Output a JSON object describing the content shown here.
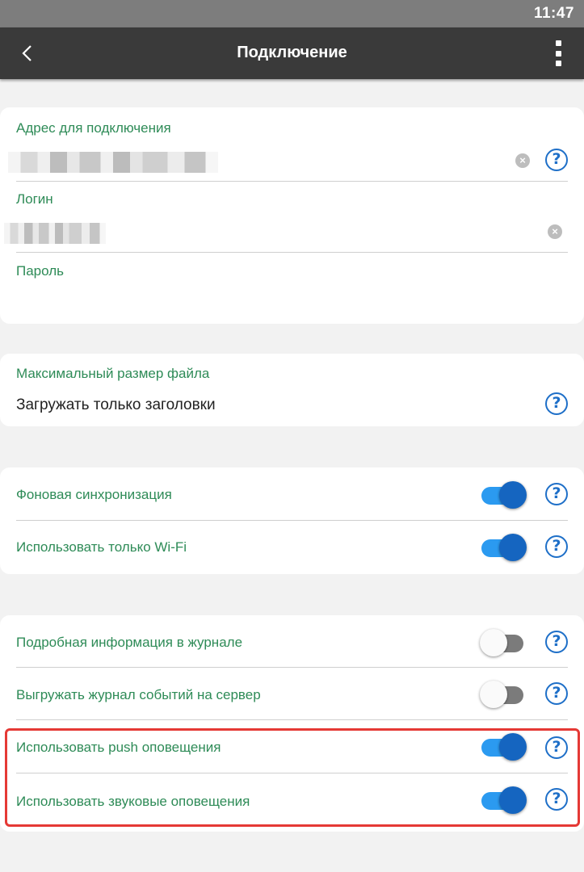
{
  "status_bar": {
    "time": "11:47"
  },
  "app_bar": {
    "title": "Подключение",
    "back_icon": "chevron-left-icon",
    "menu_icon": "more-vertical-icon"
  },
  "connection": {
    "address_label": "Адрес для подключения",
    "login_label": "Логин",
    "password_label": "Пароль"
  },
  "file_size": {
    "label": "Максимальный размер файла",
    "value": "Загружать только заголовки"
  },
  "sync": {
    "items": [
      {
        "label": "Фоновая синхронизация",
        "on": true
      },
      {
        "label": "Использовать только Wi-Fi",
        "on": true
      }
    ]
  },
  "logging": {
    "items": [
      {
        "label": "Подробная информация в журнале",
        "on": false
      },
      {
        "label": "Выгружать журнал событий на сервер",
        "on": false
      },
      {
        "label": "Использовать push оповещения",
        "on": true
      },
      {
        "label": "Использовать звуковые оповещения",
        "on": true
      }
    ]
  },
  "help_symbol": "?",
  "clear_symbol": "×",
  "colors": {
    "accent_green": "#2e8b57",
    "help_blue": "#1e6fc8",
    "toggle_on": "#1565c0",
    "highlight": "#e53935"
  }
}
